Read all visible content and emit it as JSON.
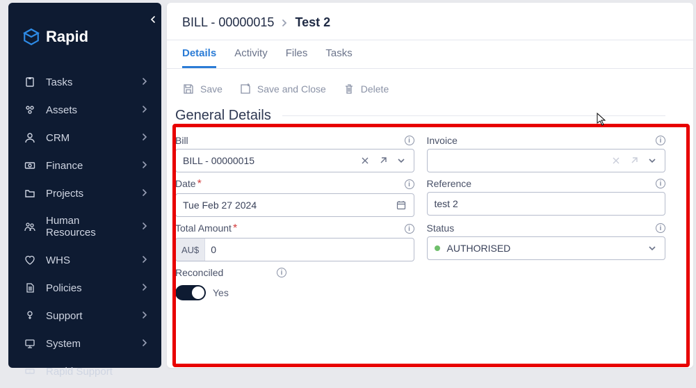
{
  "brand": {
    "name": "Rapid"
  },
  "sidebar": {
    "items": [
      {
        "label": "Tasks"
      },
      {
        "label": "Assets"
      },
      {
        "label": "CRM"
      },
      {
        "label": "Finance"
      },
      {
        "label": "Projects"
      },
      {
        "label": "Human Resources"
      },
      {
        "label": "WHS"
      },
      {
        "label": "Policies"
      },
      {
        "label": "Support"
      },
      {
        "label": "System"
      },
      {
        "label": "Rapid Support"
      }
    ]
  },
  "breadcrumb": {
    "parent": "BILL - 00000015",
    "current": "Test 2"
  },
  "tabs": [
    {
      "label": "Details",
      "active": true
    },
    {
      "label": "Activity"
    },
    {
      "label": "Files"
    },
    {
      "label": "Tasks"
    }
  ],
  "toolbar": {
    "save": "Save",
    "save_close": "Save and Close",
    "delete": "Delete"
  },
  "section": {
    "title": "General Details"
  },
  "form": {
    "bill": {
      "label": "Bill",
      "value": "BILL - 00000015"
    },
    "invoice": {
      "label": "Invoice",
      "value": ""
    },
    "date": {
      "label": "Date",
      "required": true,
      "value": "Tue Feb 27 2024"
    },
    "reference": {
      "label": "Reference",
      "value": "test 2"
    },
    "total_amount": {
      "label": "Total Amount",
      "required": true,
      "prefix": "AU$",
      "value": "0"
    },
    "status": {
      "label": "Status",
      "value": "AUTHORISED"
    },
    "reconciled": {
      "label": "Reconciled",
      "value": true,
      "value_label": "Yes"
    }
  }
}
